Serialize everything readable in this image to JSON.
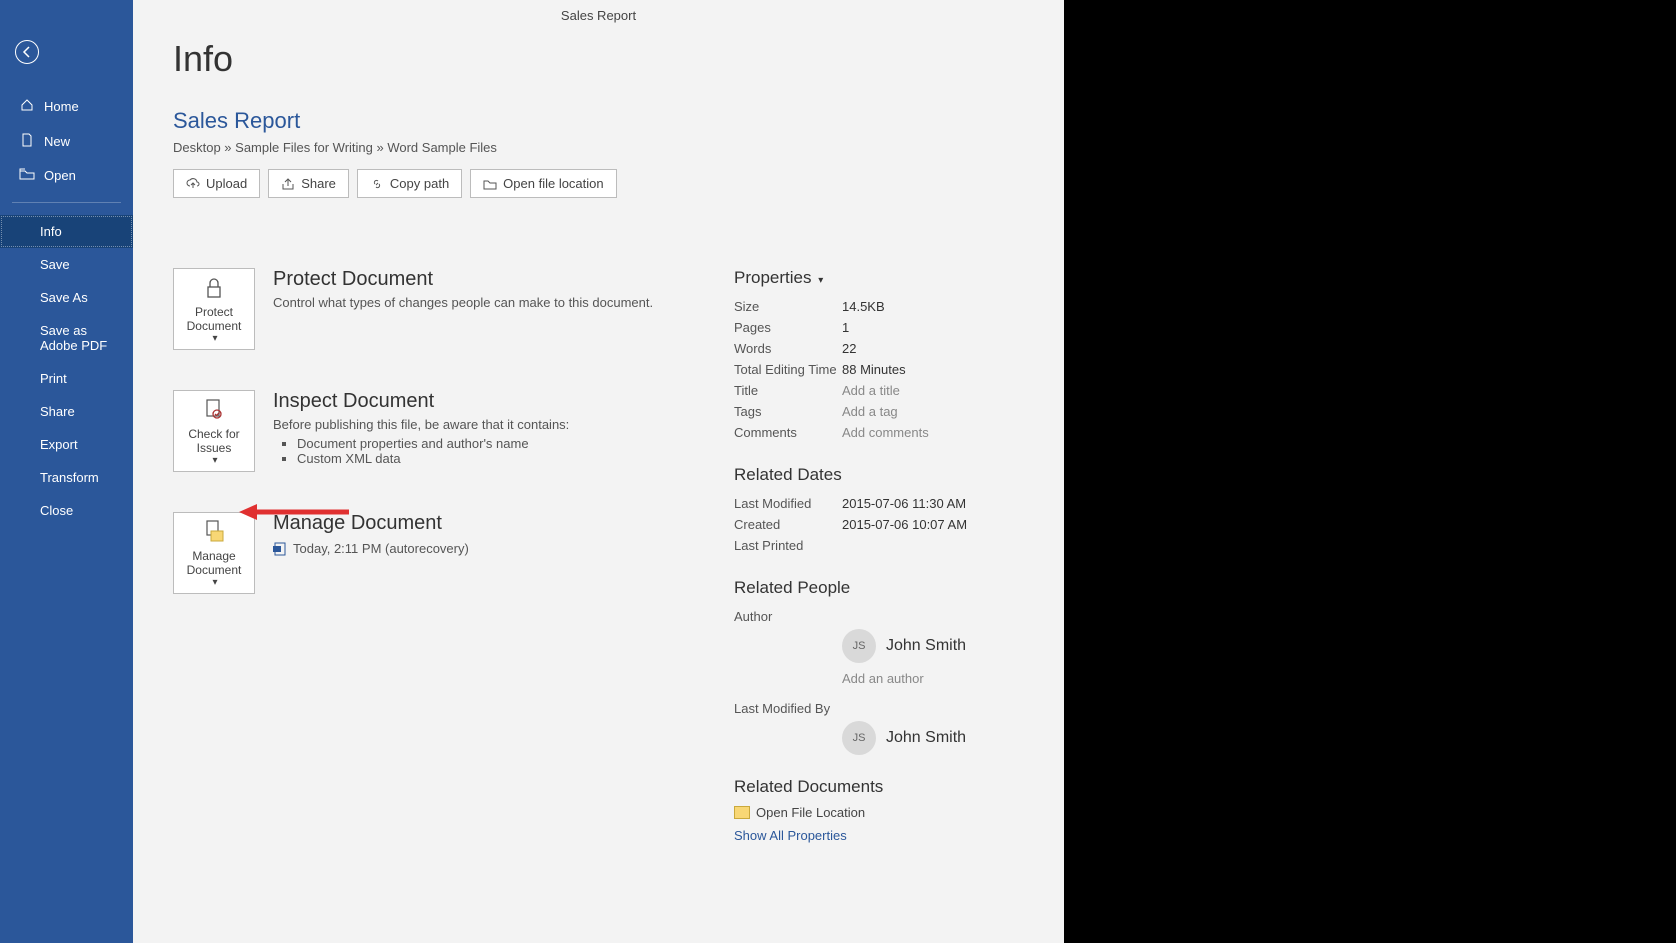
{
  "titlebar": "Sales Report",
  "sidebar": {
    "top": [
      "Home",
      "New",
      "Open"
    ],
    "sub": [
      "Info",
      "Save",
      "Save As",
      "Save as Adobe PDF",
      "Print",
      "Share",
      "Export",
      "Transform",
      "Close"
    ],
    "active": "Info"
  },
  "page": {
    "heading": "Info",
    "doc_title": "Sales Report",
    "path": "Desktop » Sample Files for Writing » Word Sample Files",
    "buttons": {
      "upload": "Upload",
      "share": "Share",
      "copy_path": "Copy path",
      "open_loc": "Open file location"
    }
  },
  "sections": {
    "protect": {
      "btn": "Protect Document",
      "title": "Protect Document",
      "desc": "Control what types of changes people can make to this document."
    },
    "inspect": {
      "btn": "Check for Issues",
      "title": "Inspect Document",
      "desc": "Before publishing this file, be aware that it contains:",
      "items": [
        "Document properties and author's name",
        "Custom XML data"
      ]
    },
    "manage": {
      "btn": "Manage Document",
      "title": "Manage Document",
      "autorecover": "Today, 2:11 PM (autorecovery)"
    }
  },
  "properties": {
    "heading": "Properties",
    "rows": {
      "size": {
        "label": "Size",
        "value": "14.5KB"
      },
      "pages": {
        "label": "Pages",
        "value": "1"
      },
      "words": {
        "label": "Words",
        "value": "22"
      },
      "edit_time": {
        "label": "Total Editing Time",
        "value": "88 Minutes"
      },
      "title": {
        "label": "Title",
        "placeholder": "Add a title"
      },
      "tags": {
        "label": "Tags",
        "placeholder": "Add a tag"
      },
      "comments": {
        "label": "Comments",
        "placeholder": "Add comments"
      }
    },
    "dates": {
      "heading": "Related Dates",
      "last_modified": {
        "label": "Last Modified",
        "value": "2015-07-06 11:30 AM"
      },
      "created": {
        "label": "Created",
        "value": "2015-07-06 10:07 AM"
      },
      "last_printed": {
        "label": "Last Printed",
        "value": ""
      }
    },
    "people": {
      "heading": "Related People",
      "author_label": "Author",
      "author": {
        "initials": "JS",
        "name": "John Smith"
      },
      "add_author": "Add an author",
      "modified_by_label": "Last Modified By",
      "modified_by": {
        "initials": "JS",
        "name": "John Smith"
      }
    },
    "docs": {
      "heading": "Related Documents",
      "open_loc": "Open File Location",
      "show_all": "Show All Properties"
    }
  }
}
